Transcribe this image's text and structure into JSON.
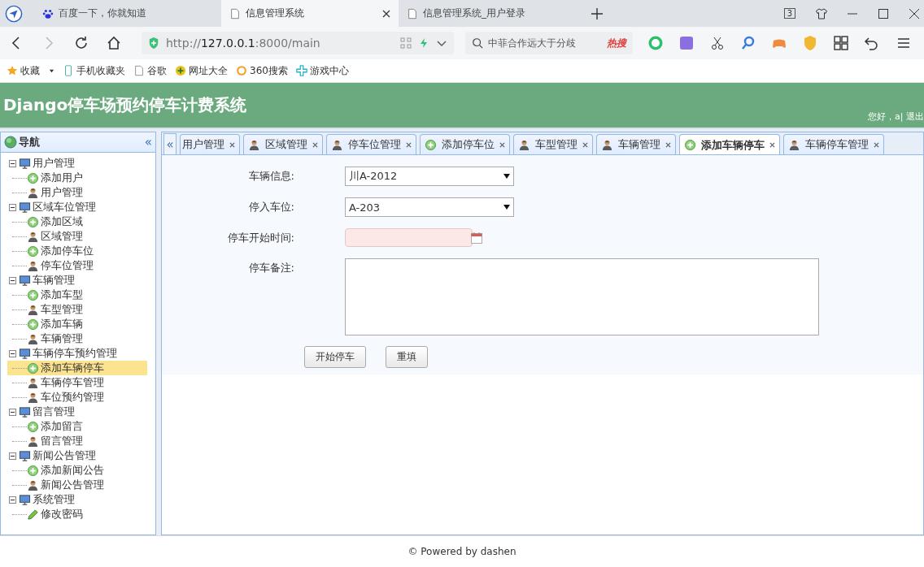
{
  "browser_tabs": [
    {
      "title": "百度一下，你就知道",
      "kind": "paw",
      "selected": false
    },
    {
      "title": "信息管理系统",
      "kind": "page",
      "selected": true
    },
    {
      "title": "信息管理系统_用户登录",
      "kind": "page",
      "selected": false
    }
  ],
  "tab_count": "3",
  "address": {
    "url_prefix": "http://",
    "url_host": "127.0.0.1",
    "url_rest": ":8000/main"
  },
  "search": {
    "value": "中菲合作远大于分歧",
    "badge": "热搜"
  },
  "bookmarks": [
    {
      "label": "收藏",
      "kind": "star"
    },
    {
      "label": "手机收藏夹",
      "kind": "phone"
    },
    {
      "label": "谷歌",
      "kind": "page"
    },
    {
      "label": "网址大全",
      "kind": "plus"
    },
    {
      "label": "360搜索",
      "kind": "ring"
    },
    {
      "label": "游戏中心",
      "kind": "cross"
    }
  ],
  "header": {
    "title": "Django停车场预约停车计费系统",
    "greeting": "您好，a| 退出"
  },
  "nav": {
    "title": "导航",
    "collapse": "«",
    "tree": [
      {
        "label": "用户管理",
        "expanded": true,
        "children": [
          {
            "label": "添加用户",
            "kind": "add",
            "selected": false
          },
          {
            "label": "用户管理",
            "kind": "manage",
            "selected": false
          }
        ]
      },
      {
        "label": "区域车位管理",
        "expanded": true,
        "children": [
          {
            "label": "添加区域",
            "kind": "add",
            "selected": false
          },
          {
            "label": "区域管理",
            "kind": "manage",
            "selected": false
          },
          {
            "label": "添加停车位",
            "kind": "add",
            "selected": false
          },
          {
            "label": "停车位管理",
            "kind": "manage",
            "selected": false
          }
        ]
      },
      {
        "label": "车辆管理",
        "expanded": true,
        "children": [
          {
            "label": "添加车型",
            "kind": "add",
            "selected": false
          },
          {
            "label": "车型管理",
            "kind": "manage",
            "selected": false
          },
          {
            "label": "添加车辆",
            "kind": "add",
            "selected": false
          },
          {
            "label": "车辆管理",
            "kind": "manage",
            "selected": false
          }
        ]
      },
      {
        "label": "车辆停车预约管理",
        "expanded": true,
        "children": [
          {
            "label": "添加车辆停车",
            "kind": "add",
            "selected": true
          },
          {
            "label": "车辆停车管理",
            "kind": "manage",
            "selected": false
          },
          {
            "label": "车位预约管理",
            "kind": "manage",
            "selected": false
          }
        ]
      },
      {
        "label": "留言管理",
        "expanded": true,
        "children": [
          {
            "label": "添加留言",
            "kind": "add",
            "selected": false
          },
          {
            "label": "留言管理",
            "kind": "manage",
            "selected": false
          }
        ]
      },
      {
        "label": "新闻公告管理",
        "expanded": true,
        "children": [
          {
            "label": "添加新闻公告",
            "kind": "add",
            "selected": false
          },
          {
            "label": "新闻公告管理",
            "kind": "manage",
            "selected": false
          }
        ]
      },
      {
        "label": "系统管理",
        "expanded": true,
        "children": [
          {
            "label": "修改密码",
            "kind": "edit",
            "selected": false
          }
        ]
      }
    ]
  },
  "tabs_scroll": "«",
  "tabs": [
    {
      "label": "用户管理",
      "selected": false
    },
    {
      "label": "区域管理",
      "kind": "manage",
      "selected": false
    },
    {
      "label": "停车位管理",
      "kind": "manage",
      "selected": false
    },
    {
      "label": "添加停车位",
      "kind": "add",
      "selected": false
    },
    {
      "label": "车型管理",
      "kind": "manage",
      "selected": false
    },
    {
      "label": "车辆管理",
      "kind": "manage",
      "selected": false
    },
    {
      "label": "添加车辆停车",
      "kind": "add",
      "selected": true
    },
    {
      "label": "车辆停车管理",
      "kind": "manage",
      "selected": false
    }
  ],
  "form": {
    "fields": [
      {
        "label": "车辆信息:",
        "kind": "select",
        "value": "川A-2012"
      },
      {
        "label": "停入车位:",
        "kind": "select",
        "value": "A-203"
      },
      {
        "label": "停车开始时间:",
        "kind": "date",
        "invalid": true
      },
      {
        "label": "停车备注:",
        "kind": "textarea"
      }
    ],
    "buttons": [
      "开始停车",
      "重填"
    ]
  },
  "footer": "© Powered by dashen"
}
